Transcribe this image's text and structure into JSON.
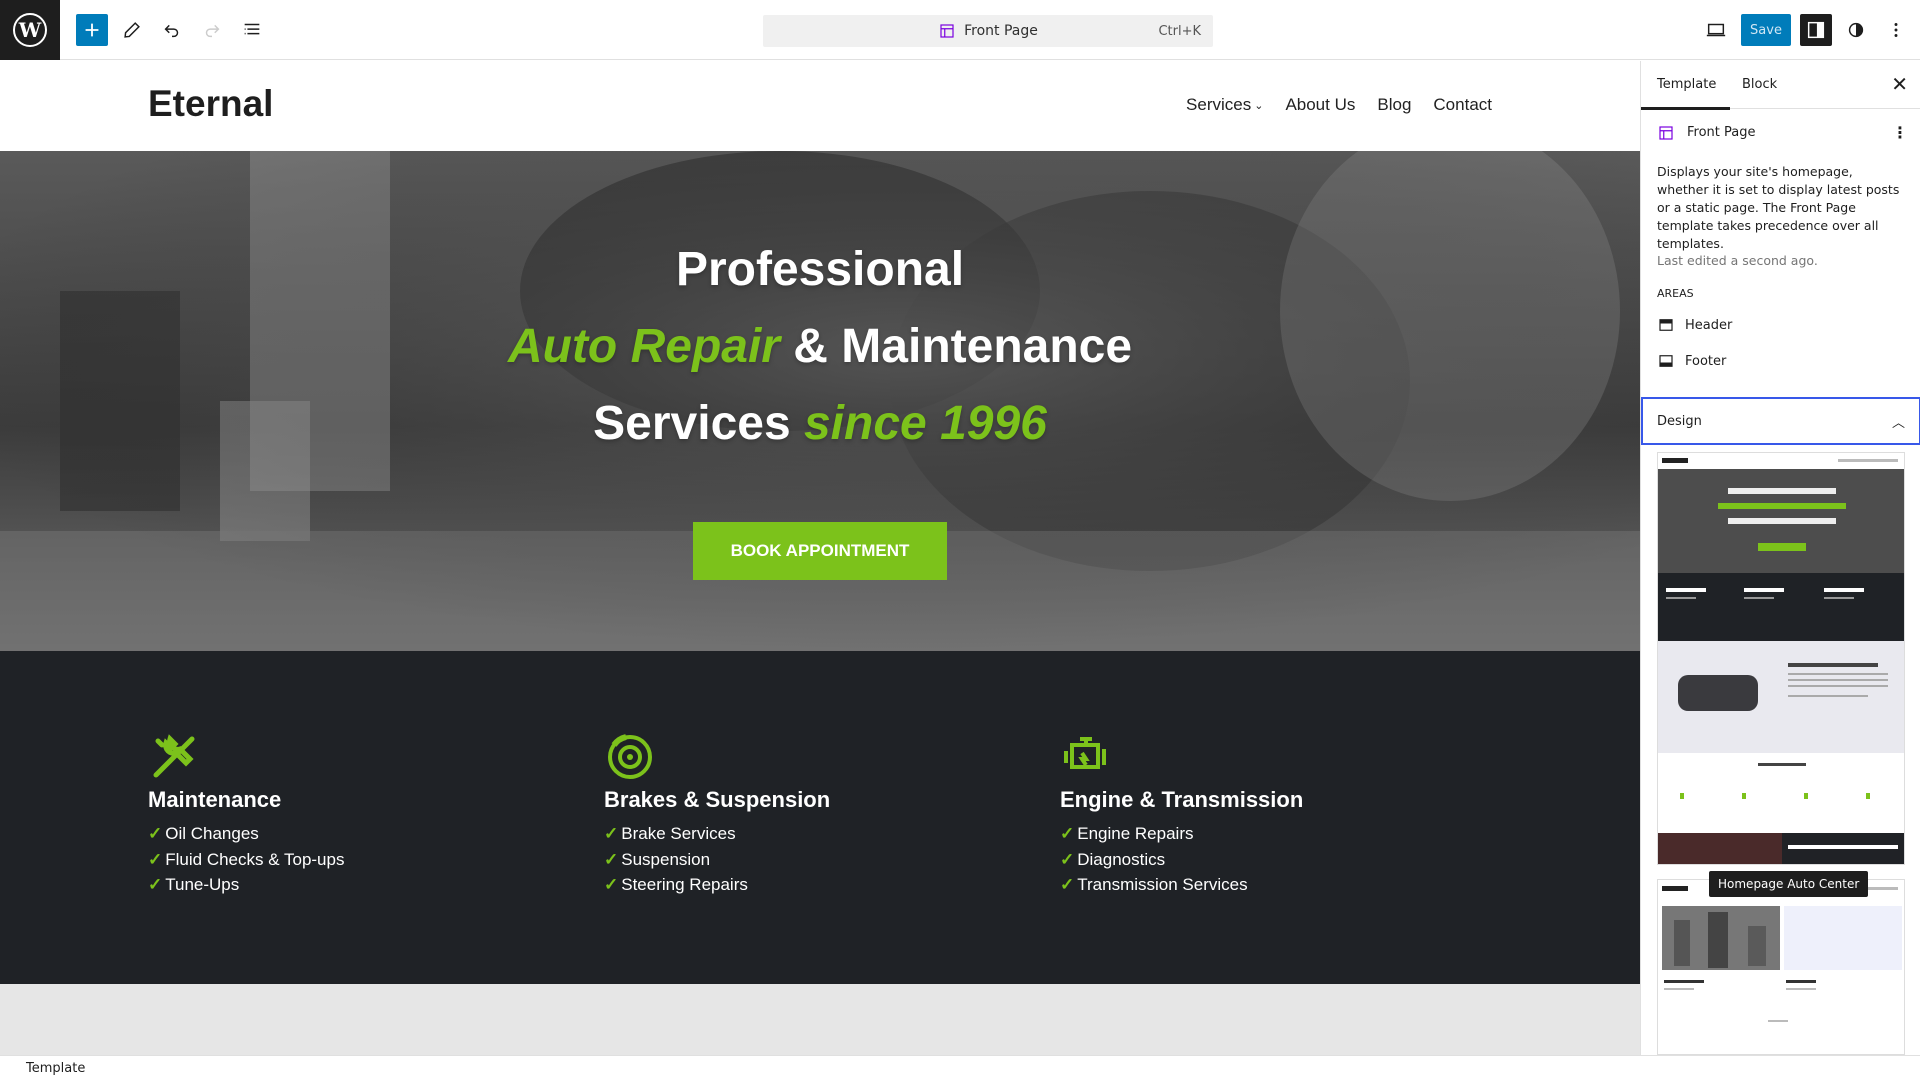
{
  "toolbar": {
    "logo_letter": "W",
    "logo_icon": "wordpress-icon",
    "command_title": "Front Page",
    "command_shortcut": "Ctrl+K",
    "save_label": "Save",
    "accent_color": "#007cba",
    "template_color": "#7a00df"
  },
  "site": {
    "title": "Eternal",
    "nav": {
      "services": "Services",
      "about": "About Us",
      "blog": "Blog",
      "contact": "Contact"
    },
    "hero": {
      "line1": "Professional",
      "line2_accent": "Auto Repair",
      "line2_rest": " & Maintenance",
      "line3_plain": "Services ",
      "line3_accent": "since 1996",
      "button": "BOOK APPOINTMENT",
      "accent_color": "#7cc21b"
    },
    "services": [
      {
        "title": "Maintenance",
        "icon": "wrench-screwdriver-icon",
        "items": [
          "Oil Changes",
          "Fluid Checks & Top-ups",
          "Tune-Ups"
        ]
      },
      {
        "title": "Brakes & Suspension",
        "icon": "brake-disc-icon",
        "items": [
          "Brake Services",
          "Suspension",
          "Steering Repairs"
        ]
      },
      {
        "title": "Engine & Transmission",
        "icon": "engine-icon",
        "items": [
          "Engine Repairs",
          "Diagnostics",
          "Transmission Services"
        ]
      }
    ],
    "check_glyph": "✓"
  },
  "sidebar": {
    "tabs": {
      "template": "Template",
      "block": "Block"
    },
    "template_name": "Front Page",
    "description": "Displays your site's homepage, whether it is set to display latest posts or a static page. The Front Page template takes precedence over all templates.",
    "last_edited": "Last edited a second ago.",
    "areas_heading": "Areas",
    "areas": {
      "header": "Header",
      "footer": "Footer"
    },
    "design_label": "Design",
    "tooltip": "Homepage Auto Center"
  },
  "status": {
    "breadcrumb": "Template"
  }
}
